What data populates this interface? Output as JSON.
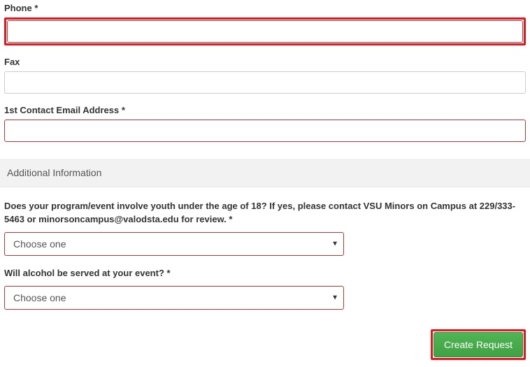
{
  "fields": {
    "phone": {
      "label": "Phone *"
    },
    "fax": {
      "label": "Fax"
    },
    "email1": {
      "label": "1st Contact Email Address *"
    }
  },
  "section": {
    "title": "Additional Information"
  },
  "questions": {
    "youth": {
      "label": "Does your program/event involve youth under the age of 18? If yes, please contact VSU Minors on Campus at 229/333-5463 or minorsoncampus@valodsta.edu for review. *",
      "placeholder": "Choose one"
    },
    "alcohol": {
      "label": "Will alcohol be served at your event? *",
      "placeholder": "Choose one"
    }
  },
  "buttons": {
    "create": "Create Request"
  }
}
